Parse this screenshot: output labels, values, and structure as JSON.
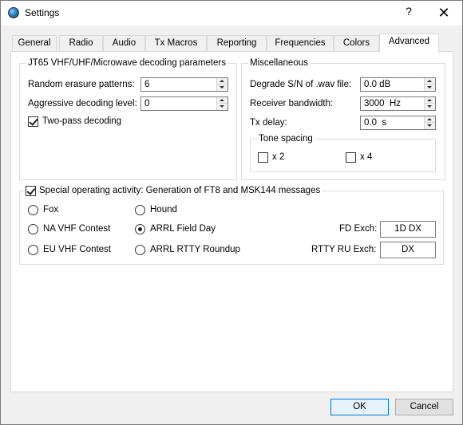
{
  "window": {
    "title": "Settings",
    "help_glyph": "?",
    "close_glyph": "✕"
  },
  "tabs": [
    {
      "label": "General"
    },
    {
      "label": "Radio"
    },
    {
      "label": "Audio"
    },
    {
      "label": "Tx Macros"
    },
    {
      "label": "Reporting"
    },
    {
      "label": "Frequencies"
    },
    {
      "label": "Colors"
    },
    {
      "label": "Advanced",
      "active": true
    }
  ],
  "jt65": {
    "title": "JT65 VHF/UHF/Microwave decoding parameters",
    "random_erasure_label": "Random erasure patterns:",
    "random_erasure_value": "6",
    "aggressive_label": "Aggressive decoding level:",
    "aggressive_value": "0",
    "two_pass_label": "Two-pass decoding",
    "two_pass_checked": true
  },
  "misc": {
    "title": "Miscellaneous",
    "degrade_label": "Degrade S/N of .wav file:",
    "degrade_value": "0.0 dB",
    "rx_bw_label": "Receiver bandwidth:",
    "rx_bw_value": "3000  Hz",
    "tx_delay_label": "Tx delay:",
    "tx_delay_value": "0.0  s",
    "tone_spacing": {
      "title": "Tone spacing",
      "x2_label": "x 2",
      "x2_checked": false,
      "x4_label": "x 4",
      "x4_checked": false
    }
  },
  "special": {
    "title": "Special operating activity:  Generation of FT8 and MSK144 messages",
    "checked": true,
    "options": {
      "fox": "Fox",
      "hound": "Hound",
      "na_vhf": "NA VHF Contest",
      "field_day": "ARRL Field Day",
      "eu_vhf": "EU VHF Contest",
      "rtty": "ARRL RTTY Roundup"
    },
    "selected": "field_day",
    "fd_exch_label": "FD Exch:",
    "fd_exch_value": "1D DX",
    "rtty_exch_label": "RTTY RU Exch:",
    "rtty_exch_value": "DX"
  },
  "buttons": {
    "ok": "OK",
    "cancel": "Cancel"
  },
  "colors": {
    "accent": "#0078d7"
  }
}
